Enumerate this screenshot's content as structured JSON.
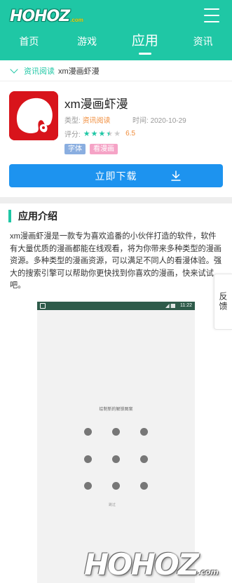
{
  "header": {
    "logo_text": "HOHOZ",
    "logo_suffix": ".com",
    "nav": [
      {
        "label": "首页"
      },
      {
        "label": "游戏"
      },
      {
        "label": "应用"
      },
      {
        "label": "资讯"
      }
    ],
    "active_nav": "应用"
  },
  "breadcrumb": {
    "category": "资讯阅读",
    "current": "xm漫画虾漫"
  },
  "app": {
    "name": "xm漫画虾漫",
    "type_label": "类型:",
    "type_value": "资讯阅读",
    "time_label": "时间:",
    "time_value": "2020-10-29",
    "rating_label": "评分:",
    "rating_value": "6.5",
    "stars_filled": 3.5,
    "stars_total": 5,
    "tags": [
      "字体",
      "看漫画"
    ],
    "download_label": "立即下载"
  },
  "intro": {
    "title": "应用介绍",
    "text": "xm漫画虾漫是一款专为喜欢追番的小伙伴打造的软件，软件有大量优质的漫画都能在线观看，将为你带来多种类型的漫画资源。多种类型的漫画资源，可以满足不同人的看漫体验。强大的搜索引擎可以帮助你更快找到你喜欢的漫画，快来试试吧。"
  },
  "feedback": {
    "label": "反馈"
  },
  "screenshot": {
    "status_time": "11:22",
    "pattern_title": "绘制新的解锁图案",
    "small_text": "跳过"
  },
  "watermark": {
    "text": "HOHOZ",
    "suffix": ".com"
  },
  "colors": {
    "brand": "#1fc7a5",
    "download": "#1d93ef",
    "accent_orange": "#f08c3a",
    "app_icon": "#d8141b"
  }
}
